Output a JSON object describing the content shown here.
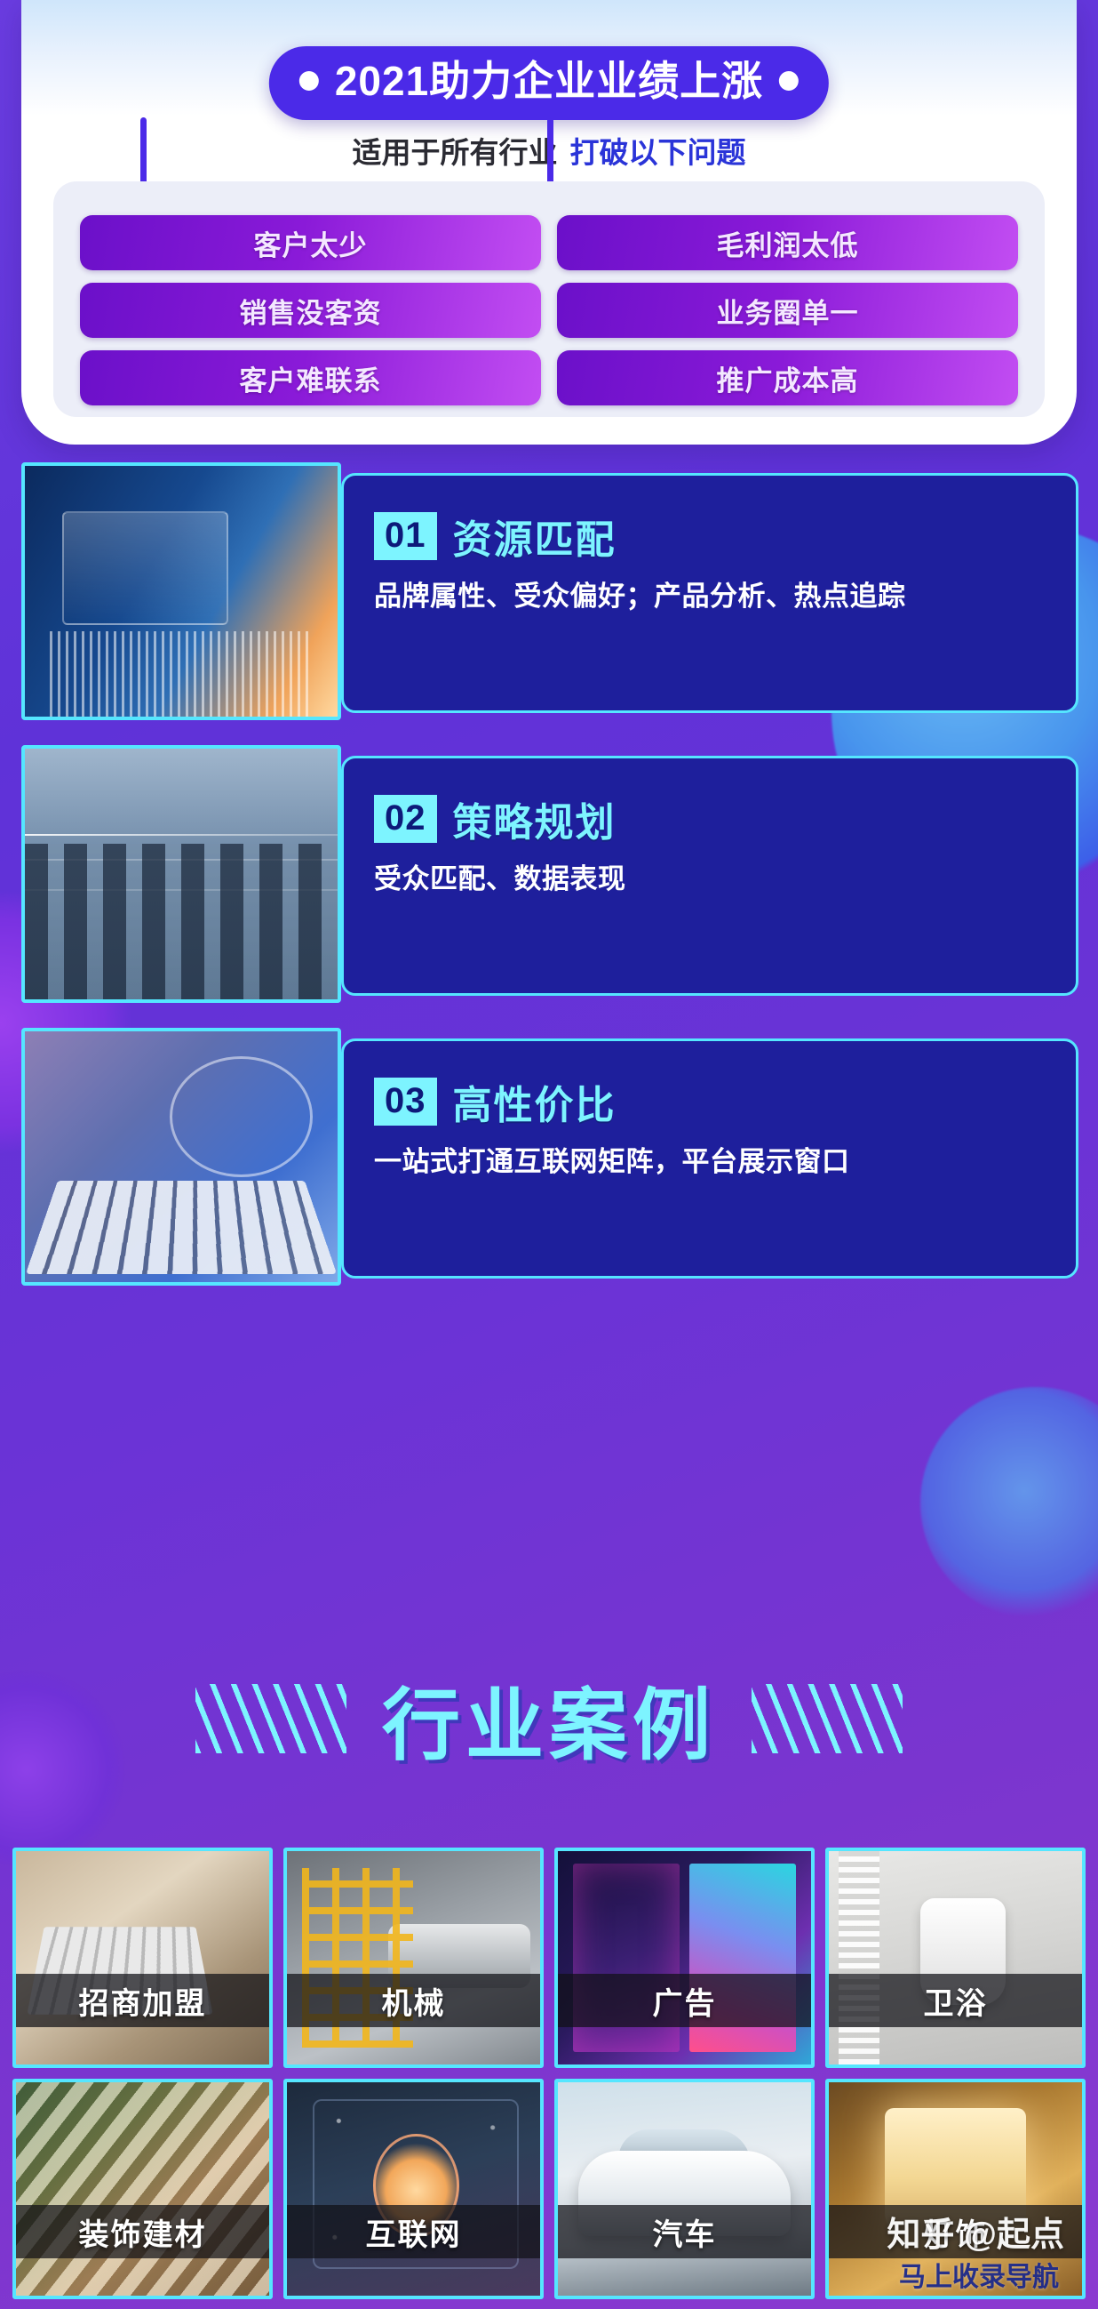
{
  "hero": {
    "title": "2021助力企业业绩上涨",
    "subtitle_normal": "适用于所有行业",
    "subtitle_accent": "打破以下问题",
    "problems": [
      "客户太少",
      "毛利润太低",
      "销售没客资",
      "业务圈单一",
      "客户难联系",
      "推广成本高"
    ]
  },
  "features": [
    {
      "number": "01",
      "title": "资源匹配",
      "desc": "品牌属性、受众偏好；产品分析、热点追踪",
      "thumb": "data-dashboard-laptop-image"
    },
    {
      "number": "02",
      "title": "策略规划",
      "desc": "受众匹配、数据表现",
      "thumb": "city-skyline-chart-image"
    },
    {
      "number": "03",
      "title": "高性价比",
      "desc": "一站式打通互联网矩阵，平台展示窗口",
      "thumb": "hands-on-laptop-image"
    }
  ],
  "cases": {
    "section_title": "行业案例",
    "items": [
      {
        "label": "招商加盟",
        "thumb": "typing-on-laptop-image"
      },
      {
        "label": "机械",
        "thumb": "industrial-machinery-image"
      },
      {
        "label": "广告",
        "thumb": "music-party-posters-image"
      },
      {
        "label": "卫浴",
        "thumb": "bathroom-toilet-image"
      },
      {
        "label": "装饰建材",
        "thumb": "building-materials-image"
      },
      {
        "label": "互联网",
        "thumb": "smart-home-network-image"
      },
      {
        "label": "汽车",
        "thumb": "white-car-image"
      },
      {
        "label": "灯饰",
        "thumb": "lamp-lighting-image"
      }
    ]
  },
  "watermarks": {
    "zhihu": "知乎 @起点",
    "nav": "马上收录导航"
  },
  "colors": {
    "page_bg": "#5b2fd4",
    "ribbon": "#4b2ae8",
    "pill_from": "#6b10c9",
    "pill_to": "#c24df2",
    "cyan_accent": "#7df4ff",
    "card_bg": "#1e1f9c",
    "card_border": "#55e6ff",
    "subtitle_accent": "#2a34d8"
  }
}
